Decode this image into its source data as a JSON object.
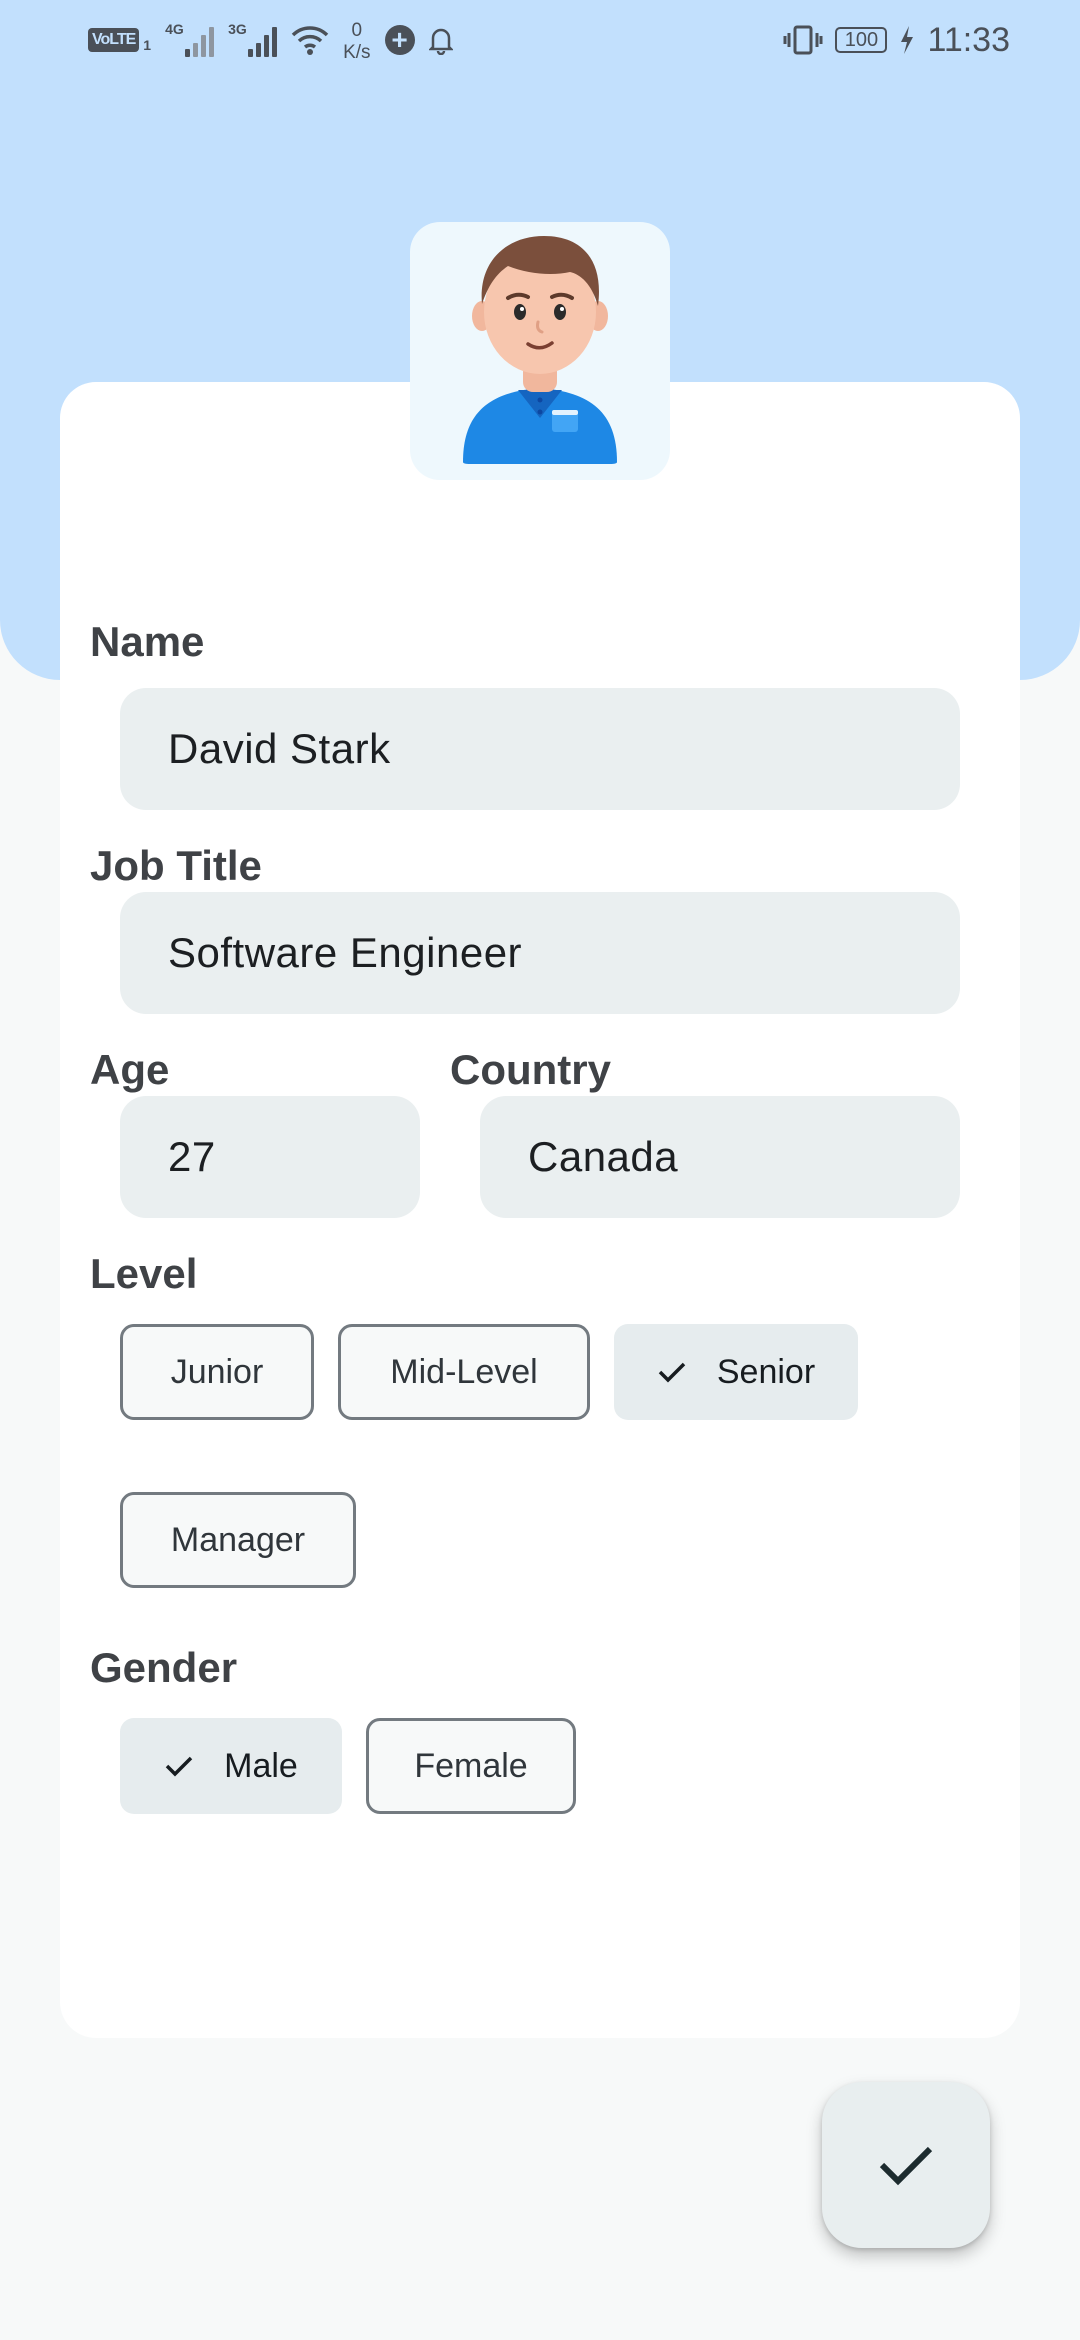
{
  "status_bar": {
    "volte": "VoLTE",
    "sim1": "1",
    "net1": "4G",
    "net2": "3G",
    "speed_value": "0",
    "speed_unit": "K/s",
    "battery": "100",
    "time": "11:33"
  },
  "form": {
    "name": {
      "label": "Name",
      "value": "David Stark"
    },
    "job_title": {
      "label": "Job Title",
      "value": "Software Engineer"
    },
    "age": {
      "label": "Age",
      "value": "27"
    },
    "country": {
      "label": "Country",
      "value": "Canada"
    },
    "level": {
      "label": "Level",
      "options": [
        "Junior",
        "Mid-Level",
        "Senior",
        "Manager"
      ],
      "selected": "Senior"
    },
    "gender": {
      "label": "Gender",
      "options": [
        "Male",
        "Female"
      ],
      "selected": "Male"
    }
  },
  "icons": {
    "avatar": "person-avatar-illustration",
    "fab": "check-icon"
  },
  "colors": {
    "header": "#c2e0fd",
    "input_bg": "#eaeff0",
    "selected_chip": "#e6ecee",
    "avatar_shirt": "#1e88e5"
  }
}
